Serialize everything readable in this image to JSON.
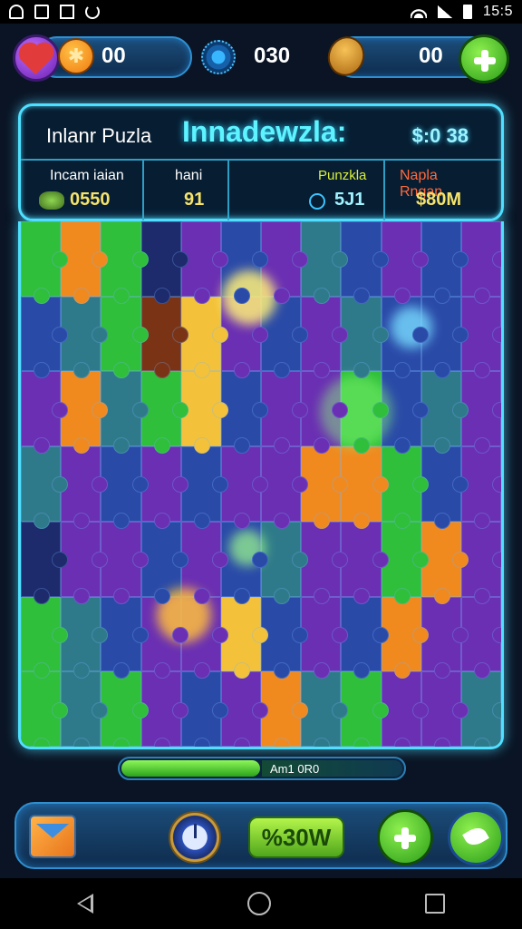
{
  "status_bar": {
    "time": "15:5",
    "icons": [
      "app-icon-a",
      "app-icon-b",
      "image-icon",
      "sync-icon",
      "wifi-icon",
      "signal-icon",
      "battery-icon"
    ]
  },
  "hud": {
    "lives_value": "00",
    "center_value": "030",
    "tickets_value": "00"
  },
  "panel": {
    "title_small": "Inlanr Puzla",
    "title_big": "Innadewzla:",
    "money": "$:0 38",
    "stats": [
      {
        "label": "Incam iaian",
        "value": "0550"
      },
      {
        "label": "hani",
        "value": "91"
      },
      {
        "label": "Punzkla",
        "value": "5J1"
      },
      {
        "label": "Napla Rngan",
        "value": "$80M"
      }
    ]
  },
  "board": {
    "colors": {
      "purple": "#6a2fb3",
      "blue": "#2a4aa8",
      "teal": "#2f7a8a",
      "green": "#2fbf3a",
      "orange": "#f08a1f",
      "yellow": "#f3c23a",
      "brown": "#7a3315",
      "dark": "#1d2a6b"
    },
    "rows": [
      [
        "green",
        "orange",
        "green",
        "dark",
        "purple",
        "blue",
        "purple",
        "teal",
        "blue",
        "purple",
        "blue",
        "purple"
      ],
      [
        "blue",
        "teal",
        "green",
        "brown",
        "yellow",
        "purple",
        "blue",
        "purple",
        "teal",
        "blue",
        "blue",
        "purple"
      ],
      [
        "purple",
        "orange",
        "teal",
        "green",
        "yellow",
        "blue",
        "purple",
        "purple",
        "green",
        "blue",
        "teal",
        "purple"
      ],
      [
        "teal",
        "purple",
        "blue",
        "purple",
        "blue",
        "purple",
        "purple",
        "orange",
        "orange",
        "green",
        "blue",
        "purple"
      ],
      [
        "dark",
        "purple",
        "purple",
        "blue",
        "purple",
        "blue",
        "teal",
        "purple",
        "purple",
        "green",
        "orange",
        "purple"
      ],
      [
        "green",
        "teal",
        "blue",
        "purple",
        "purple",
        "yellow",
        "blue",
        "purple",
        "blue",
        "orange",
        "purple",
        "purple"
      ],
      [
        "green",
        "teal",
        "green",
        "purple",
        "blue",
        "purple",
        "orange",
        "teal",
        "green",
        "purple",
        "purple",
        "teal"
      ]
    ]
  },
  "progress": {
    "fraction": 0.5,
    "label": "Am1 0R0"
  },
  "bottom_bar": {
    "bonus_label": "%30W"
  }
}
